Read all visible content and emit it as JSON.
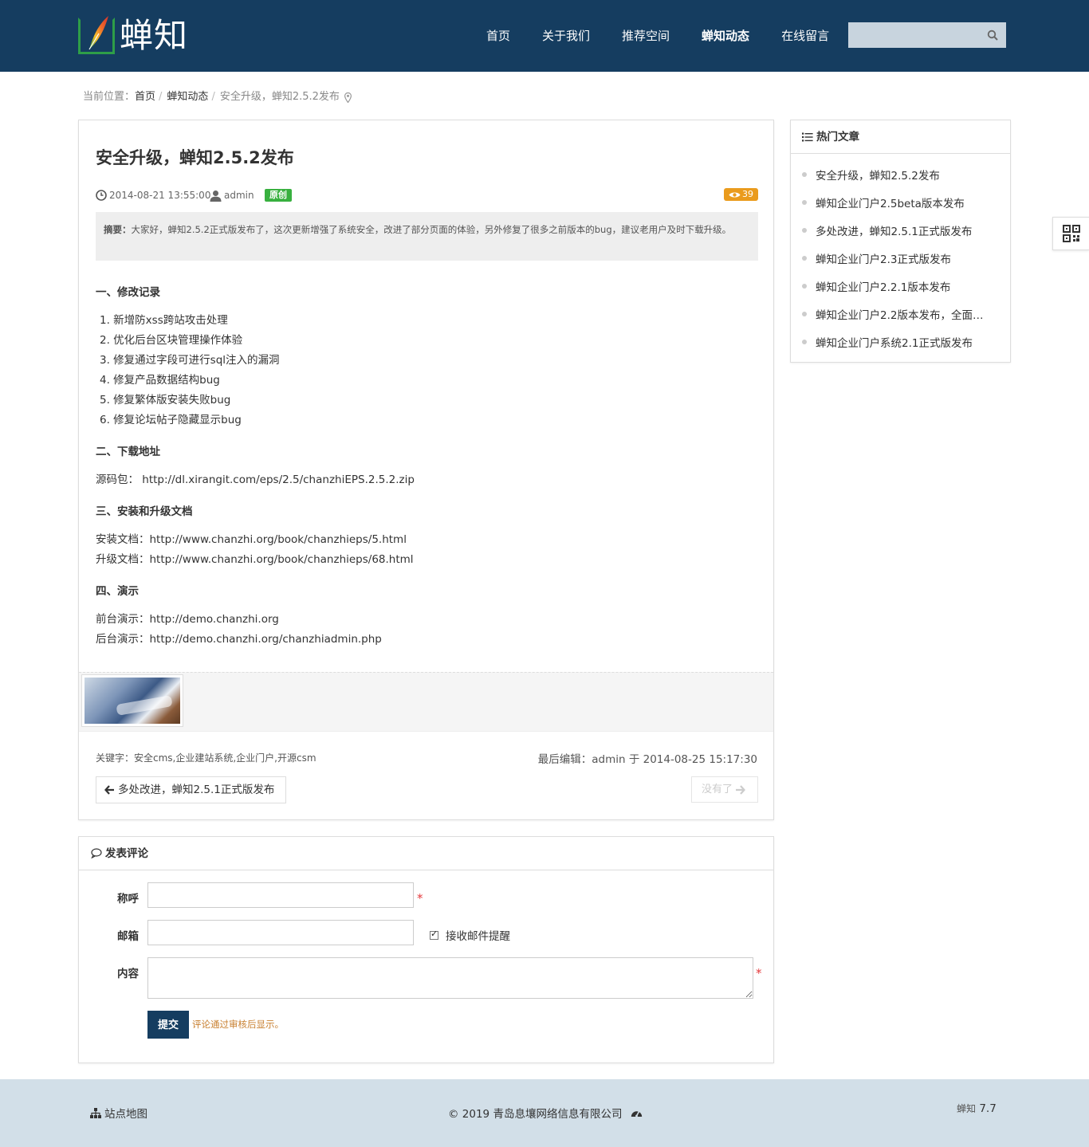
{
  "header": {
    "logo_text": "蝉知",
    "nav": [
      {
        "label": "首页",
        "active": false
      },
      {
        "label": "关于我们",
        "active": false
      },
      {
        "label": "推荐空间",
        "active": false
      },
      {
        "label": "蝉知动态",
        "active": true
      },
      {
        "label": "在线留言",
        "active": false
      }
    ],
    "search": {
      "value": "",
      "placeholder": ""
    }
  },
  "breadcrumb": {
    "prefix": "当前位置：",
    "items": [
      "首页",
      "蝉知动态"
    ],
    "current": "安全升级，蝉知2.5.2发布"
  },
  "article": {
    "title": "安全升级，蝉知2.5.2发布",
    "date": "2014-08-21 13:55:00",
    "author": "admin",
    "badge": "原创",
    "views": "39",
    "summary_label": "摘要：",
    "summary_text": "大家好，蝉知2.5.2正式版发布了，这次更新增强了系统安全，改进了部分页面的体验，另外修复了很多之前版本的bug，建议老用户及时下载升级。",
    "section1_title": "一、修改记录",
    "changes": [
      "1. 新增防xss跨站攻击处理",
      "2. 优化后台区块管理操作体验",
      "3. 修复通过字段可进行sql注入的漏洞",
      "4. 修复产品数据结构bug",
      "5. 修复繁体版安装失败bug",
      "6. 修复论坛帖子隐藏显示bug"
    ],
    "section2_title": "二、下载地址",
    "download": "源码包： http://dl.xirangit.com/eps/2.5/chanzhiEPS.2.5.2.zip",
    "section3_title": "三、安装和升级文档",
    "install_doc": "安装文档：http://www.chanzhi.org/book/chanzhieps/5.html",
    "upgrade_doc": "升级文档：http://www.chanzhi.org/book/chanzhieps/68.html",
    "section4_title": "四、演示",
    "front_demo": "前台演示：http://demo.chanzhi.org",
    "admin_demo": "后台演示：http://demo.chanzhi.org/chanzhiadmin.php",
    "keywords": "关键字：安全cms,企业建站系统,企业门户,开源csm",
    "last_edit": "最后编辑：admin 于 2014-08-25 15:17:30",
    "prev_label": "多处改进，蝉知2.5.1正式版发布",
    "next_label": "没有了"
  },
  "comment": {
    "title": "发表评论",
    "name_label": "称呼",
    "email_label": "邮箱",
    "content_label": "内容",
    "notify_label": "接收邮件提醒",
    "notify_checked": true,
    "required_mark": "*",
    "submit_label": "提交",
    "hint": "评论通过审核后显示。"
  },
  "sidebar": {
    "title": "热门文章",
    "items": [
      "安全升级，蝉知2.5.2发布",
      "蝉知企业门户2.5beta版本发布",
      "多处改进，蝉知2.5.1正式版发布",
      "蝉知企业门户2.3正式版发布",
      "蝉知企业门户2.2.1版本发布",
      "蝉知企业门户2.2版本发布，全面…",
      "蝉知企业门户系统2.1正式版发布"
    ]
  },
  "footer": {
    "sitemap": "站点地图",
    "copyright": "© 2019 青岛息壤网络信息有限公司",
    "powered_brand": "蝉知",
    "powered_version": "7.7"
  },
  "colors": {
    "header_bg": "#153d60",
    "footer_bg": "#d2dfe8",
    "badge_green": "#38b03f",
    "badge_orange": "#ea9b1d"
  }
}
